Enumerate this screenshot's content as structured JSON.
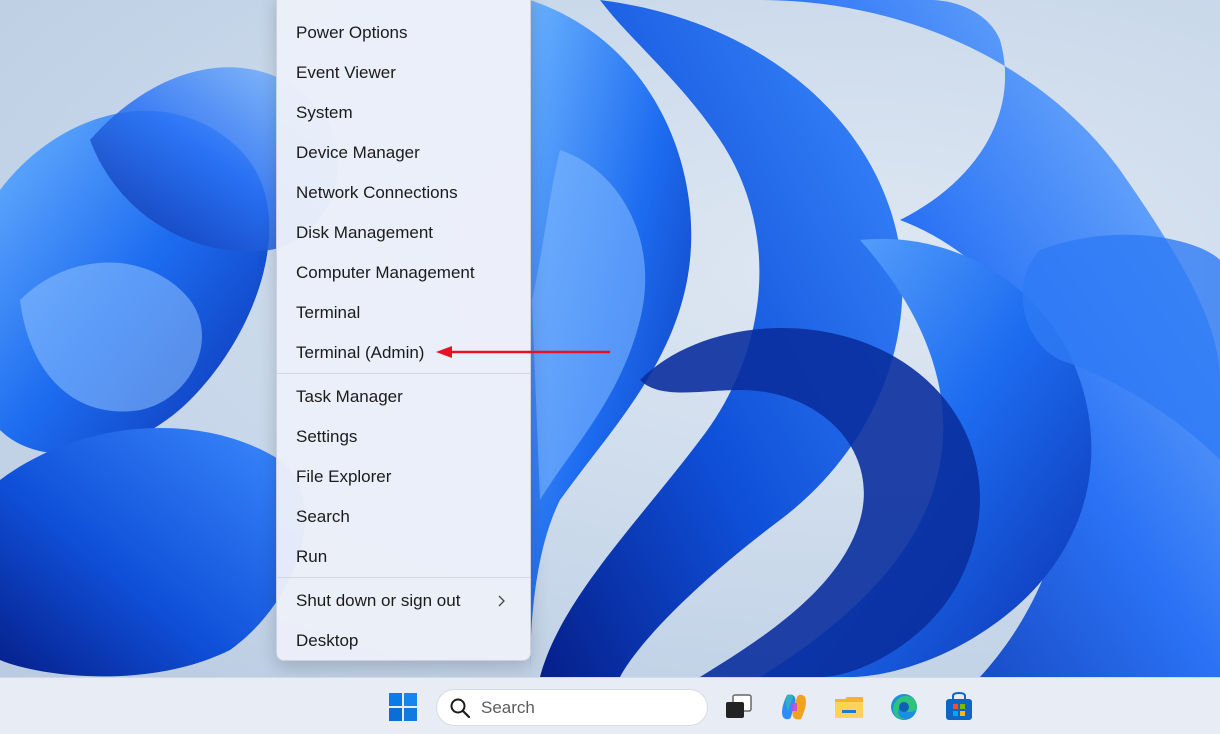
{
  "menu": {
    "items": [
      {
        "label": "Power Options"
      },
      {
        "label": "Event Viewer"
      },
      {
        "label": "System"
      },
      {
        "label": "Device Manager"
      },
      {
        "label": "Network Connections"
      },
      {
        "label": "Disk Management"
      },
      {
        "label": "Computer Management"
      },
      {
        "label": "Terminal"
      },
      {
        "label": "Terminal (Admin)"
      },
      {
        "label": "Task Manager"
      },
      {
        "label": "Settings"
      },
      {
        "label": "File Explorer"
      },
      {
        "label": "Search"
      },
      {
        "label": "Run"
      },
      {
        "label": "Shut down or sign out"
      },
      {
        "label": "Desktop"
      }
    ]
  },
  "taskbar": {
    "search_label": "Search",
    "icons": [
      "windows-start-icon",
      "search-icon",
      "task-view-icon",
      "copilot-icon",
      "file-explorer-icon",
      "edge-icon",
      "store-icon"
    ]
  },
  "colors": {
    "accent": "#0067c0",
    "annotation_arrow": "#e81123",
    "menu_bg": "#eceff9",
    "taskbar_bg": "#e8edf5"
  }
}
